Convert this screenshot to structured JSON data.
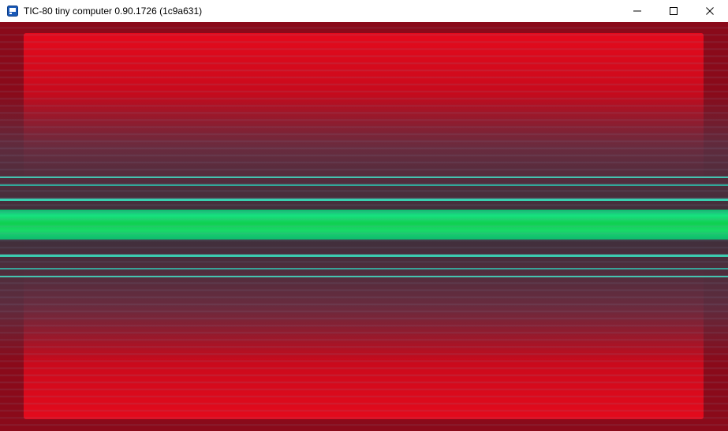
{
  "window": {
    "title": "TIC-80 tiny computer 0.90.1726 (1c9a631)",
    "app_icon": "tic80-icon",
    "controls": {
      "minimize": "minimize-icon",
      "maximize": "maximize-icon",
      "close": "close-icon"
    }
  },
  "canvas": {
    "content": "fullscreen-demo-effect",
    "colors": {
      "background": "#8a0a1a",
      "frame_red": "#e40a1c",
      "center_green": "#10d050",
      "teal_lines": "#30c0a0",
      "scanline_gray": "#6a7a90"
    }
  }
}
